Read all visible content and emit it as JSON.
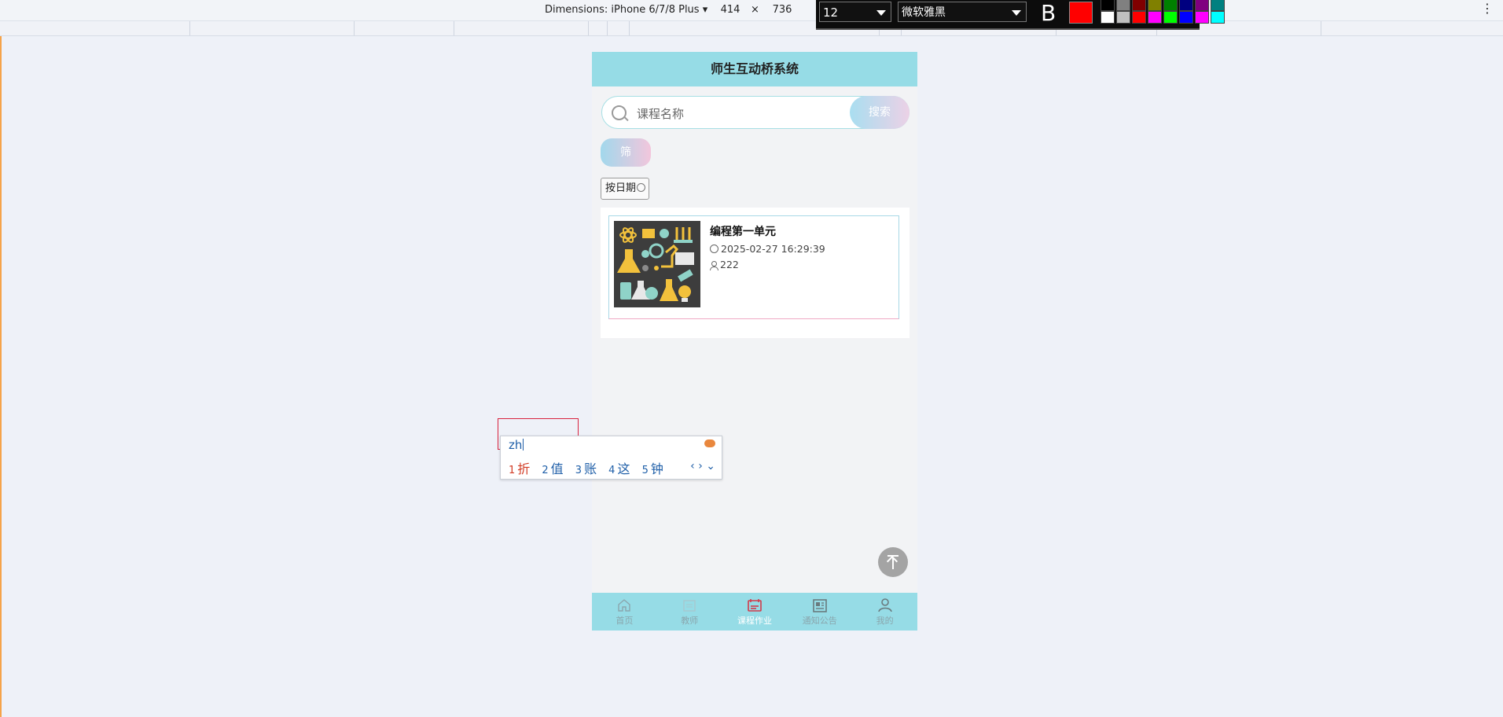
{
  "devtools": {
    "device": "Dimensions: iPhone 6/7/8 Plus ▾",
    "width": "414",
    "times": "×",
    "height": "736",
    "menu": "⋮"
  },
  "annotation": {
    "font_size": "12",
    "font_family": "微软雅黑",
    "bold": "B",
    "current_color": "#ff0000",
    "palette": [
      "#000000",
      "#808080",
      "#800000",
      "#808000",
      "#008000",
      "#000080",
      "#800080",
      "#008080",
      "#ffffff",
      "#c0c0c0",
      "#ff0000",
      "#ff00ff",
      "#00ff00",
      "#0000ff",
      "#ff00ff",
      "#00ffff"
    ]
  },
  "app": {
    "title": "师生互动桥系统",
    "search": {
      "placeholder": "课程名称",
      "button": "搜索"
    },
    "filter_button": "筛",
    "sort_button": "按日期",
    "courses": [
      {
        "title": "编程第一单元",
        "date": "2025-02-27 16:29:39",
        "views": "222"
      }
    ],
    "tabs": [
      {
        "label": "首页",
        "icon": "home-icon",
        "active": false
      },
      {
        "label": "教师",
        "icon": "teacher-icon",
        "active": false
      },
      {
        "label": "课程作业",
        "icon": "assignment-icon",
        "active": true
      },
      {
        "label": "通知公告",
        "icon": "news-icon",
        "active": false
      },
      {
        "label": "我的",
        "icon": "user-icon",
        "active": false
      }
    ]
  },
  "ime": {
    "input": "zh",
    "candidates": [
      {
        "n": "1",
        "text": "折"
      },
      {
        "n": "2",
        "text": "值"
      },
      {
        "n": "3",
        "text": "账"
      },
      {
        "n": "4",
        "text": "这"
      },
      {
        "n": "5",
        "text": "钟"
      }
    ],
    "nav": "‹ › ⌄"
  }
}
